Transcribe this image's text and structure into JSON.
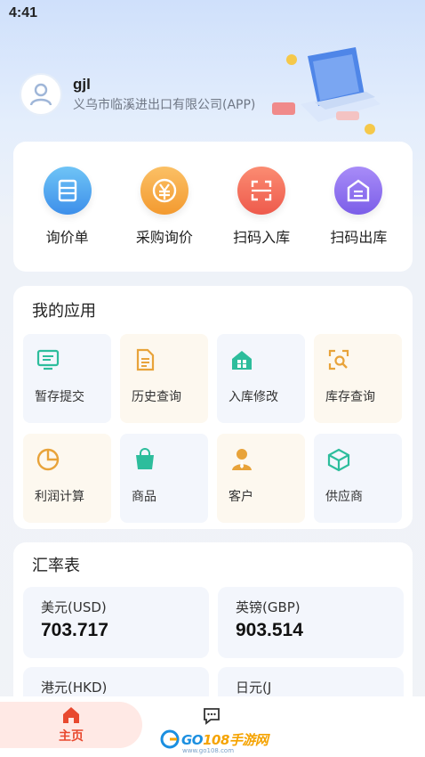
{
  "status_bar": {
    "time": "4:41"
  },
  "profile": {
    "username": "gjl",
    "company": "义乌市临溪进出口有限公司(APP)"
  },
  "quick_actions": [
    {
      "label": "询价单",
      "icon": "document-list-icon",
      "color": "#4aa3ee"
    },
    {
      "label": "采购询价",
      "icon": "yen-coin-icon",
      "color": "#f5a33c"
    },
    {
      "label": "扫码入库",
      "icon": "scan-icon",
      "color": "#f26a5a"
    },
    {
      "label": "扫码出库",
      "icon": "warehouse-icon",
      "color": "#8a6cf0"
    }
  ],
  "apps": {
    "title": "我的应用",
    "items": [
      {
        "label": "暂存提交",
        "icon": "monitor-icon",
        "color": "#2dbd9c"
      },
      {
        "label": "历史查询",
        "icon": "document-icon",
        "color": "#e8a33a"
      },
      {
        "label": "入库修改",
        "icon": "house-icon",
        "color": "#2dbd9c"
      },
      {
        "label": "库存查询",
        "icon": "search-frame-icon",
        "color": "#e8a33a"
      },
      {
        "label": "利润计算",
        "icon": "pie-chart-icon",
        "color": "#e8a33a"
      },
      {
        "label": "商品",
        "icon": "shopping-bag-icon",
        "color": "#2dbd9c"
      },
      {
        "label": "客户",
        "icon": "person-icon",
        "color": "#e8a33a"
      },
      {
        "label": "供应商",
        "icon": "cube-icon",
        "color": "#2dbd9c"
      }
    ]
  },
  "rates": {
    "title": "汇率表",
    "items": [
      {
        "name": "美元(USD)",
        "value": "703.717"
      },
      {
        "name": "英镑(GBP)",
        "value": "903.514"
      },
      {
        "name": "港元(HKD)",
        "value": ""
      },
      {
        "name": "日元(J",
        "value": ""
      }
    ]
  },
  "bottom_nav": {
    "home_label": "主页",
    "messages_icon": "chat-icon"
  },
  "watermark": {
    "text_a": "GO",
    "text_b": "108手游网",
    "sub": "www.go108.com"
  }
}
